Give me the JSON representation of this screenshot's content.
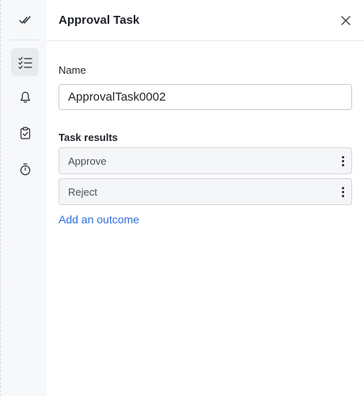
{
  "rail": {
    "items": [
      {
        "icon": "checkmarks-icon",
        "active": false
      },
      {
        "icon": "task-list-icon",
        "active": true
      },
      {
        "icon": "bell-icon",
        "active": false
      },
      {
        "icon": "clipboard-check-icon",
        "active": false
      },
      {
        "icon": "stopwatch-icon",
        "active": false
      }
    ]
  },
  "panel": {
    "title": "Approval Task",
    "close_icon": "close-icon",
    "name_label": "Name",
    "name_value": "ApprovalTask0002",
    "results_label": "Task results",
    "outcomes": [
      {
        "label": "Approve",
        "menu_icon": "kebab-menu-icon"
      },
      {
        "label": "Reject",
        "menu_icon": "kebab-menu-icon"
      }
    ],
    "add_outcome_label": "Add an outcome"
  },
  "colors": {
    "accent_link": "#2f6fde",
    "rail_bg": "#f7f8fa",
    "rail_active_bg": "#e8eaee",
    "outcome_bg": "#f5f6f8"
  }
}
